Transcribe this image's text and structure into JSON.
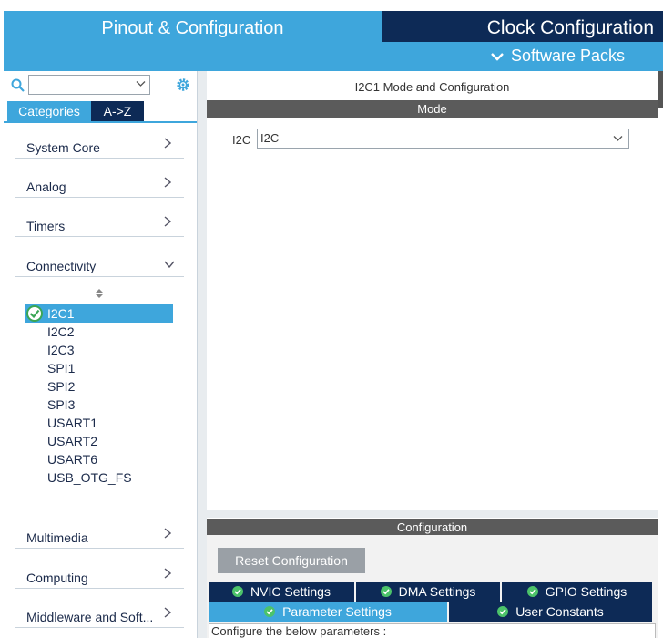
{
  "header": {
    "tab_pinout": "Pinout & Configuration",
    "tab_clock": "Clock Configuration",
    "software_packs": "Software Packs"
  },
  "sidebar": {
    "search_placeholder": "",
    "tab_categories": "Categories",
    "tab_az": "A->Z",
    "categories": [
      {
        "label": "System Core"
      },
      {
        "label": "Analog"
      },
      {
        "label": "Timers"
      },
      {
        "label": "Connectivity"
      },
      {
        "label": "Multimedia"
      },
      {
        "label": "Computing"
      },
      {
        "label": "Middleware and Soft..."
      }
    ],
    "connectivity_items": [
      {
        "label": "I2C1"
      },
      {
        "label": "I2C2"
      },
      {
        "label": "I2C3"
      },
      {
        "label": "SPI1"
      },
      {
        "label": "SPI2"
      },
      {
        "label": "SPI3"
      },
      {
        "label": "USART1"
      },
      {
        "label": "USART2"
      },
      {
        "label": "USART6"
      },
      {
        "label": "USB_OTG_FS"
      }
    ]
  },
  "main": {
    "title": "I2C1 Mode and Configuration",
    "mode_header": "Mode",
    "i2c_label": "I2C",
    "i2c_value": "I2C",
    "config_header": "Configuration",
    "reset_button": "Reset Configuration",
    "tabs": [
      {
        "label": "NVIC Settings"
      },
      {
        "label": "DMA Settings"
      },
      {
        "label": "GPIO Settings"
      },
      {
        "label": "Parameter Settings"
      },
      {
        "label": "User Constants"
      }
    ],
    "params_text": "Configure the below parameters :"
  },
  "colors": {
    "accent": "#3ea6dc",
    "dark": "#0d2a56",
    "header_grey": "#5b5b5b"
  }
}
